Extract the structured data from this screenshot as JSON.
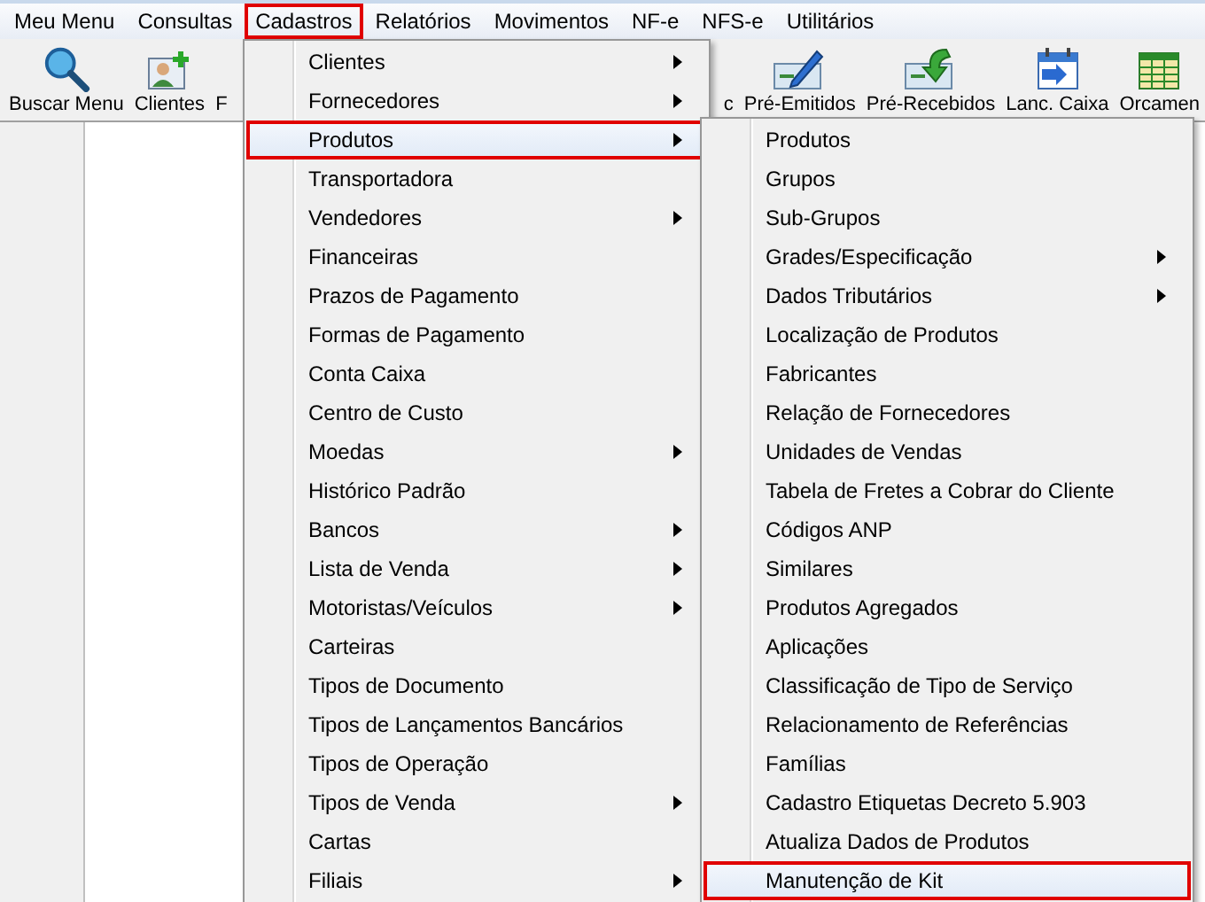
{
  "menubar": [
    {
      "label": "Meu Menu",
      "selected": false
    },
    {
      "label": "Consultas",
      "selected": false
    },
    {
      "label": "Cadastros",
      "selected": true
    },
    {
      "label": "Relatórios",
      "selected": false
    },
    {
      "label": "Movimentos",
      "selected": false
    },
    {
      "label": "NF-e",
      "selected": false
    },
    {
      "label": "NFS-e",
      "selected": false
    },
    {
      "label": "Utilitários",
      "selected": false
    }
  ],
  "toolbar_left": [
    {
      "label": "Buscar Menu",
      "kind": "search"
    },
    {
      "label": "Clientes",
      "kind": "client"
    },
    {
      "label": "F",
      "kind": "none"
    }
  ],
  "toolbar_right": [
    {
      "label": "c",
      "kind": "none"
    },
    {
      "label": "Pré-Emitidos",
      "kind": "check-pen"
    },
    {
      "label": "Pré-Recebidos",
      "kind": "check-arrow"
    },
    {
      "label": "Lanc. Caixa",
      "kind": "calendar"
    },
    {
      "label": "Orcamen",
      "kind": "sheet"
    }
  ],
  "menu": [
    {
      "label": "Clientes",
      "submenu": true,
      "selected": false
    },
    {
      "label": "Fornecedores",
      "submenu": true,
      "selected": false
    },
    {
      "label": "Produtos",
      "submenu": true,
      "selected": true
    },
    {
      "label": "Transportadora",
      "submenu": false,
      "selected": false
    },
    {
      "label": "Vendedores",
      "submenu": true,
      "selected": false
    },
    {
      "label": "Financeiras",
      "submenu": false,
      "selected": false
    },
    {
      "label": "Prazos de Pagamento",
      "submenu": false,
      "selected": false
    },
    {
      "label": "Formas de Pagamento",
      "submenu": false,
      "selected": false
    },
    {
      "label": "Conta Caixa",
      "submenu": false,
      "selected": false
    },
    {
      "label": "Centro de Custo",
      "submenu": false,
      "selected": false
    },
    {
      "label": "Moedas",
      "submenu": true,
      "selected": false
    },
    {
      "label": "Histórico Padrão",
      "submenu": false,
      "selected": false
    },
    {
      "label": "Bancos",
      "submenu": true,
      "selected": false
    },
    {
      "label": "Lista de Venda",
      "submenu": true,
      "selected": false
    },
    {
      "label": "Motoristas/Veículos",
      "submenu": true,
      "selected": false
    },
    {
      "label": "Carteiras",
      "submenu": false,
      "selected": false
    },
    {
      "label": "Tipos de Documento",
      "submenu": false,
      "selected": false
    },
    {
      "label": "Tipos de Lançamentos Bancários",
      "submenu": false,
      "selected": false
    },
    {
      "label": "Tipos de Operação",
      "submenu": false,
      "selected": false
    },
    {
      "label": "Tipos de Venda",
      "submenu": true,
      "selected": false
    },
    {
      "label": "Cartas",
      "submenu": false,
      "selected": false
    },
    {
      "label": "Filiais",
      "submenu": true,
      "selected": false
    }
  ],
  "submenu": [
    {
      "label": "Produtos",
      "submenu": false,
      "selected": false
    },
    {
      "label": "Grupos",
      "submenu": false,
      "selected": false
    },
    {
      "label": "Sub-Grupos",
      "submenu": false,
      "selected": false
    },
    {
      "label": "Grades/Especificação",
      "submenu": true,
      "selected": false
    },
    {
      "label": "Dados Tributários",
      "submenu": true,
      "selected": false
    },
    {
      "label": "Localização de Produtos",
      "submenu": false,
      "selected": false
    },
    {
      "label": "Fabricantes",
      "submenu": false,
      "selected": false
    },
    {
      "label": "Relação de Fornecedores",
      "submenu": false,
      "selected": false
    },
    {
      "label": "Unidades de Vendas",
      "submenu": false,
      "selected": false
    },
    {
      "label": "Tabela de Fretes a Cobrar do Cliente",
      "submenu": false,
      "selected": false
    },
    {
      "label": "Códigos ANP",
      "submenu": false,
      "selected": false
    },
    {
      "label": "Similares",
      "submenu": false,
      "selected": false
    },
    {
      "label": "Produtos Agregados",
      "submenu": false,
      "selected": false
    },
    {
      "label": "Aplicações",
      "submenu": false,
      "selected": false
    },
    {
      "label": "Classificação de Tipo de Serviço",
      "submenu": false,
      "selected": false
    },
    {
      "label": "Relacionamento de Referências",
      "submenu": false,
      "selected": false
    },
    {
      "label": "Famílias",
      "submenu": false,
      "selected": false
    },
    {
      "label": "Cadastro Etiquetas Decreto 5.903",
      "submenu": false,
      "selected": false
    },
    {
      "label": "Atualiza Dados de Produtos",
      "submenu": false,
      "selected": false
    },
    {
      "label": "Manutenção de Kit",
      "submenu": false,
      "selected": true
    }
  ]
}
